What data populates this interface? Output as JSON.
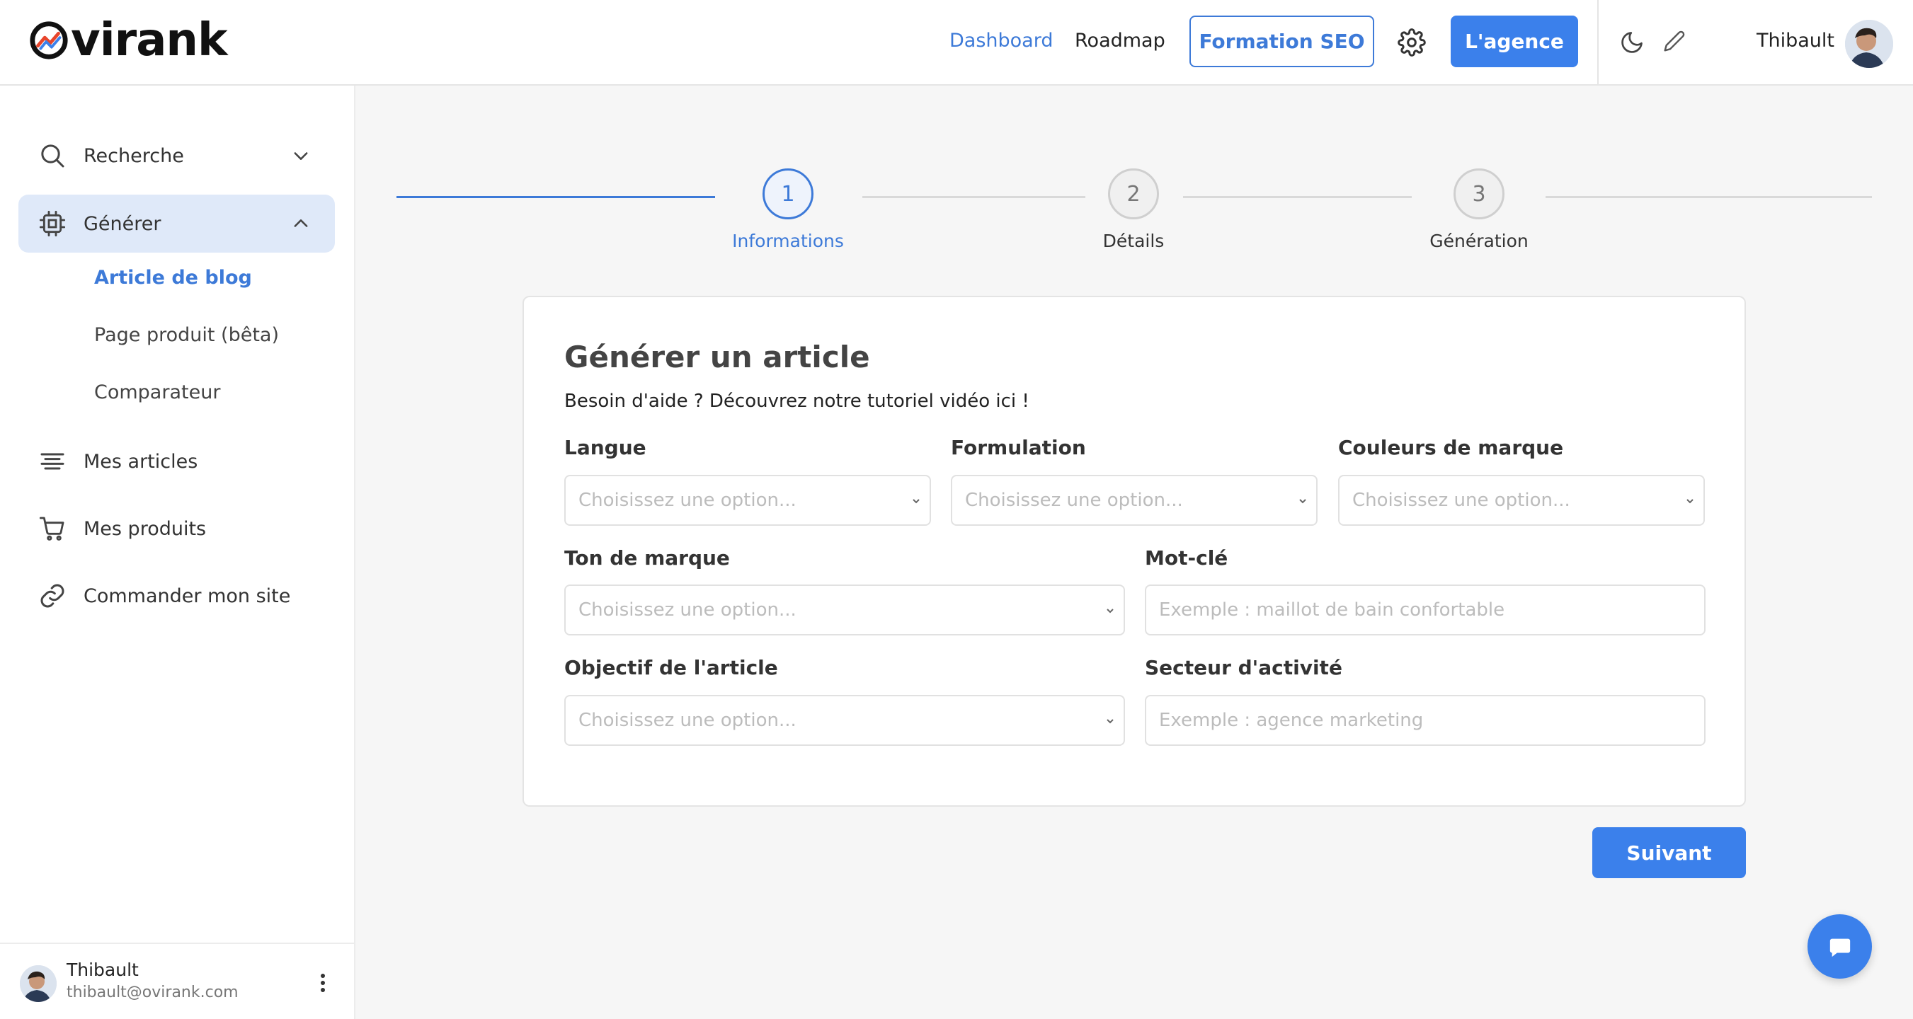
{
  "app": {
    "logo_text": "virank",
    "brand_color": "#3b80eb"
  },
  "topnav": {
    "dashboard": "Dashboard",
    "roadmap": "Roadmap",
    "formation": "Formation SEO",
    "agence": "L'agence",
    "username": "Thibault"
  },
  "sidebar": {
    "recherche": "Recherche",
    "generer": "Générer",
    "sub_items": [
      "Article de blog",
      "Page produit (bêta)",
      "Comparateur"
    ],
    "mes_articles": "Mes articles",
    "mes_produits": "Mes produits",
    "commander": "Commander mon site",
    "user_name": "Thibault",
    "user_email": "thibault@ovirank.com"
  },
  "stepper": {
    "steps": [
      {
        "number": "1",
        "label": "Informations",
        "state": "active"
      },
      {
        "number": "2",
        "label": "Détails",
        "state": "todo"
      },
      {
        "number": "3",
        "label": "Génération",
        "state": "todo"
      }
    ]
  },
  "form": {
    "title": "Générer un article",
    "help": "Besoin d'aide ? Découvrez notre tutoriel vidéo ici !",
    "langue_label": "Langue",
    "langue_placeholder": "Choisissez une option...",
    "formulation_label": "Formulation",
    "formulation_placeholder": "Choisissez une option...",
    "couleurs_label": "Couleurs de marque",
    "couleurs_placeholder": "Choisissez une option...",
    "ton_label": "Ton de marque",
    "ton_placeholder": "Choisissez une option...",
    "motcle_label": "Mot-clé",
    "motcle_placeholder": "Exemple : maillot de bain confortable",
    "objectif_label": "Objectif de l'article",
    "objectif_placeholder": "Choisissez une option...",
    "secteur_label": "Secteur d'activité",
    "secteur_placeholder": "Exemple : agence marketing",
    "next": "Suivant"
  }
}
